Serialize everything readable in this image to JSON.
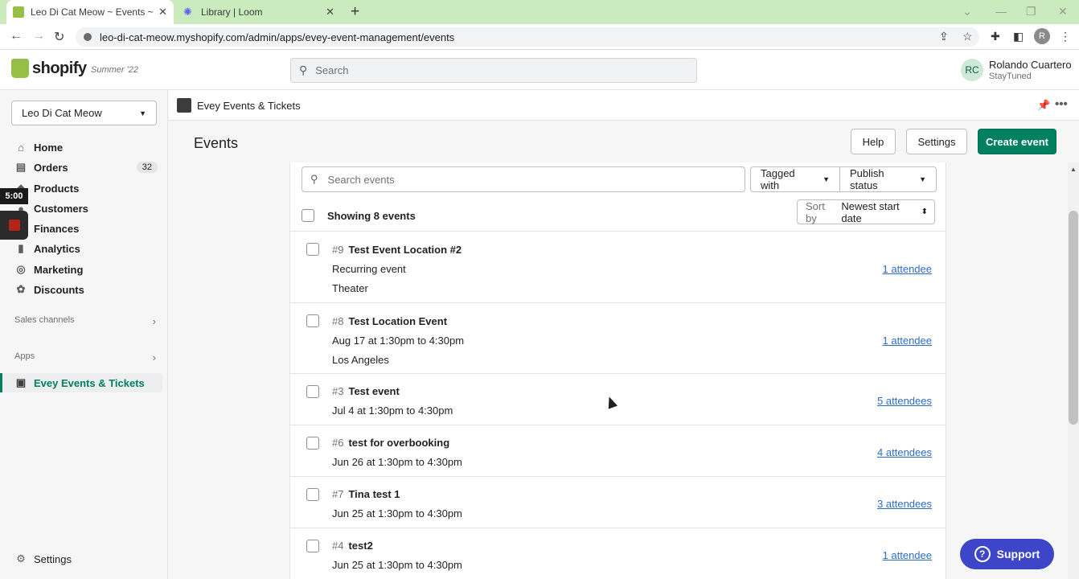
{
  "browser": {
    "tabs": [
      {
        "title": "Leo Di Cat Meow ~ Events ~ Sho",
        "active": true
      },
      {
        "title": "Library | Loom",
        "active": false
      }
    ],
    "new_tab": "+",
    "url": "leo-di-cat-meow.myshopify.com/admin/apps/evey-event-management/events",
    "profile_initial": "R"
  },
  "topbar": {
    "brand": "shopify",
    "edition": "Summer '22",
    "search_placeholder": "Search",
    "user_initials": "RC",
    "user_name": "Rolando Cuartero",
    "user_shop": "StayTuned"
  },
  "sidebar": {
    "store": "Leo Di Cat Meow",
    "items": [
      {
        "label": "Home",
        "icon": "home-icon",
        "glyph": "⌂"
      },
      {
        "label": "Orders",
        "icon": "orders-icon",
        "glyph": "▤",
        "badge": "32"
      },
      {
        "label": "Products",
        "icon": "products-icon",
        "glyph": "◆"
      },
      {
        "label": "Customers",
        "icon": "customers-icon",
        "glyph": "●"
      },
      {
        "label": "Finances",
        "icon": "finances-icon",
        "glyph": "▭"
      },
      {
        "label": "Analytics",
        "icon": "analytics-icon",
        "glyph": "▮"
      },
      {
        "label": "Marketing",
        "icon": "marketing-icon",
        "glyph": "◎"
      },
      {
        "label": "Discounts",
        "icon": "discounts-icon",
        "glyph": "✿"
      }
    ],
    "sales_channels": "Sales channels",
    "apps": "Apps",
    "active_app": "Evey Events & Tickets",
    "settings": "Settings",
    "recorder_time": "5:00"
  },
  "appbar": {
    "title": "Evey Events & Tickets"
  },
  "page": {
    "title": "Events",
    "help": "Help",
    "settings": "Settings",
    "create": "Create event"
  },
  "filters": {
    "search_placeholder": "Search events",
    "tagged": "Tagged with",
    "publish": "Publish status",
    "showing": "Showing 8 events",
    "sort_label": "Sort by",
    "sort_value": "Newest start date"
  },
  "events": [
    {
      "num": "#9",
      "name": "Test Event Location #2",
      "line2": "Recurring event",
      "line3": "Theater",
      "attendees": "1 attendee"
    },
    {
      "num": "#8",
      "name": "Test Location Event",
      "line2": "Aug 17 at 1:30pm to 4:30pm",
      "line3": "Los Angeles",
      "attendees": "1 attendee"
    },
    {
      "num": "#3",
      "name": "Test event",
      "line2": "Jul 4 at 1:30pm to 4:30pm",
      "attendees": "5 attendees"
    },
    {
      "num": "#6",
      "name": "test for overbooking",
      "line2": "Jun 26 at 1:30pm to 4:30pm",
      "attendees": "4 attendees"
    },
    {
      "num": "#7",
      "name": "Tina test 1",
      "line2": "Jun 25 at 1:30pm to 4:30pm",
      "attendees": "3 attendees"
    },
    {
      "num": "#4",
      "name": "test2",
      "line2": "Jun 25 at 1:30pm to 4:30pm",
      "attendees": "1 attendee"
    }
  ],
  "support": "Support",
  "colors": {
    "primary": "#008060",
    "link": "#2c6ecb",
    "support": "#3d46c9",
    "tabbar": "#c9ebbe"
  }
}
